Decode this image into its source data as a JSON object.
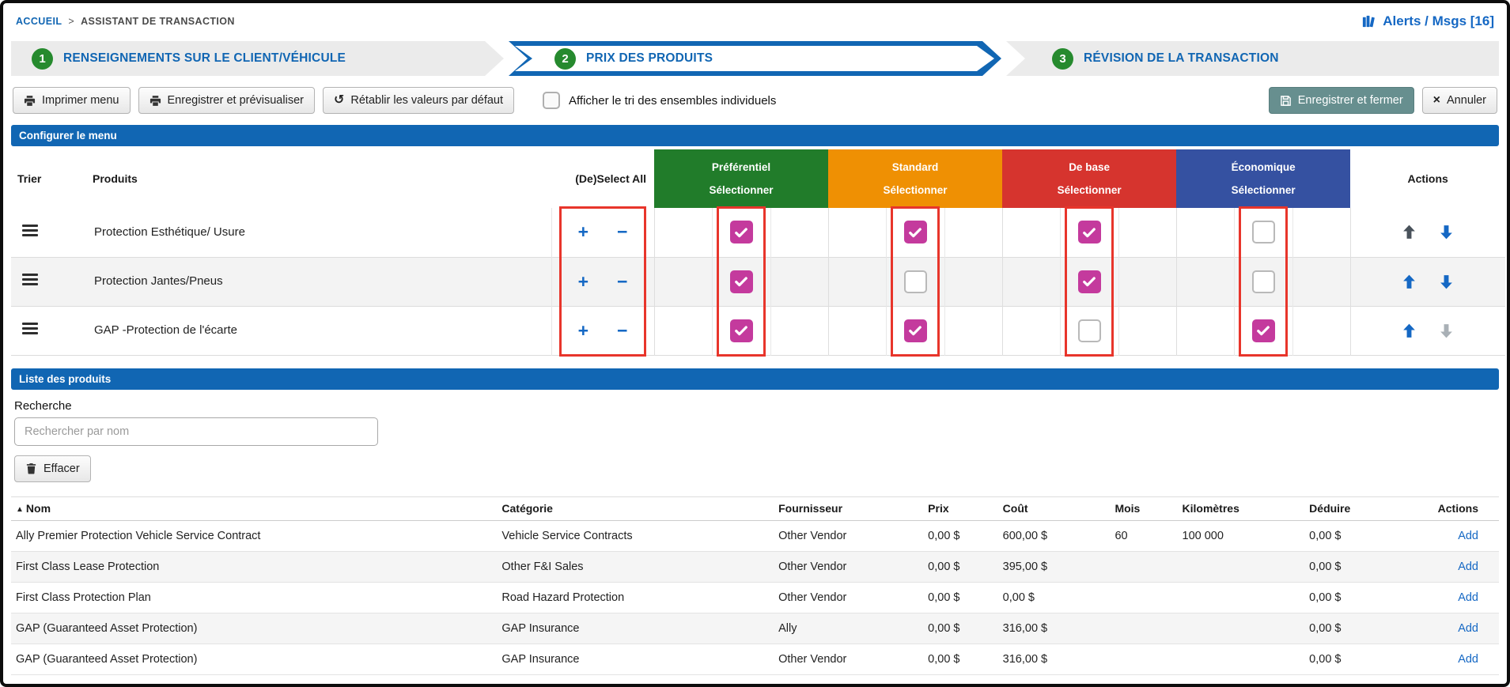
{
  "colors": {
    "primary_blue": "#1166b3",
    "step_circle_green": "#268a2e",
    "checkbox_checked_magenta": "#c43a9d",
    "annotation_red": "#e8352b",
    "link_blue": "#1568c4",
    "save_close_teal": "#678f8f"
  },
  "breadcrumb": {
    "home": "ACCUEIL",
    "separator": ">",
    "current": "ASSISTANT DE TRANSACTION"
  },
  "alerts": {
    "label": "Alerts / Msgs [16]"
  },
  "steps": [
    {
      "number": "1",
      "label": "RENSEIGNEMENTS SUR LE CLIENT/VÉHICULE",
      "active": false
    },
    {
      "number": "2",
      "label": "PRIX DES PRODUITS",
      "active": true
    },
    {
      "number": "3",
      "label": "RÉVISION DE LA TRANSACTION",
      "active": false
    }
  ],
  "toolbar": {
    "print_menu": "Imprimer menu",
    "save_preview": "Enregistrer et prévisualiser",
    "reset_defaults": "Rétablir les valeurs par défaut",
    "show_sort_label": "Afficher le tri des ensembles individuels",
    "show_sort_checked": false,
    "save_close": "Enregistrer et fermer",
    "cancel": "Annuler"
  },
  "configure_menu": {
    "title": "Configurer le menu",
    "columns": {
      "sort": "Trier",
      "products": "Produits",
      "deselect_all": "(De)Select All",
      "actions": "Actions"
    },
    "select_label": "Sélectionner",
    "plus_label": "+",
    "minus_label": "−",
    "tiers": [
      {
        "name": "Préférentiel",
        "color": "#217c2a"
      },
      {
        "name": "Standard",
        "color": "#ef9003"
      },
      {
        "name": "De base",
        "color": "#d6342e"
      },
      {
        "name": "Économique",
        "color": "#3551a1"
      }
    ],
    "rows": [
      {
        "product": "Protection Esthétique/ Usure",
        "selections": [
          true,
          true,
          true,
          false
        ],
        "up": "dark",
        "down": "blue"
      },
      {
        "product": "Protection Jantes/Pneus",
        "selections": [
          true,
          false,
          true,
          false
        ],
        "up": "blue",
        "down": "blue"
      },
      {
        "product": "GAP -Protection de l'écarte",
        "selections": [
          true,
          true,
          false,
          true
        ],
        "up": "blue",
        "down": "gray"
      }
    ]
  },
  "product_list": {
    "title": "Liste des produits",
    "search_label": "Recherche",
    "search_placeholder": "Rechercher par nom",
    "search_value": "",
    "clear_button": "Effacer",
    "columns": [
      "Nom",
      "Catégorie",
      "Fournisseur",
      "Prix",
      "Coût",
      "Mois",
      "Kilomètres",
      "Déduire",
      "Actions"
    ],
    "sort_indicator": "▲",
    "sorted_column": "Nom",
    "rows": [
      {
        "nom": "Ally Premier Protection Vehicle Service Contract",
        "categorie": "Vehicle Service Contracts",
        "fournisseur": "Other Vendor",
        "prix": "0,00 $",
        "cout": "600,00 $",
        "mois": "60",
        "kilometres": "100 000",
        "deduire": "0,00 $",
        "action": "Add"
      },
      {
        "nom": "First Class Lease Protection",
        "categorie": "Other F&I Sales",
        "fournisseur": "Other Vendor",
        "prix": "0,00 $",
        "cout": "395,00 $",
        "mois": "",
        "kilometres": "",
        "deduire": "0,00 $",
        "action": "Add"
      },
      {
        "nom": "First Class Protection Plan",
        "categorie": "Road Hazard Protection",
        "fournisseur": "Other Vendor",
        "prix": "0,00 $",
        "cout": "0,00 $",
        "mois": "",
        "kilometres": "",
        "deduire": "0,00 $",
        "action": "Add"
      },
      {
        "nom": "GAP (Guaranteed Asset Protection)",
        "categorie": "GAP Insurance",
        "fournisseur": "Ally",
        "prix": "0,00 $",
        "cout": "316,00 $",
        "mois": "",
        "kilometres": "",
        "deduire": "0,00 $",
        "action": "Add"
      },
      {
        "nom": "GAP (Guaranteed Asset Protection)",
        "categorie": "GAP Insurance",
        "fournisseur": "Other Vendor",
        "prix": "0,00 $",
        "cout": "316,00 $",
        "mois": "",
        "kilometres": "",
        "deduire": "0,00 $",
        "action": "Add"
      }
    ]
  }
}
